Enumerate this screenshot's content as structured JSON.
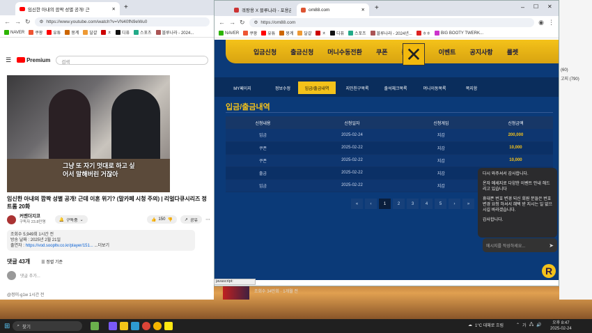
{
  "left_browser": {
    "tab_title": "임신한 아내의 깜짝 성별 공개! 근",
    "url": "https://www.youtube.com/watch?v=VN40fN9eWu0",
    "bookmarks": [
      "NAVER",
      "쿠팡",
      "유튜",
      "뭉계",
      "달걀",
      "ㅊ",
      "디퓨",
      "스포츠",
      "블루나라 - 2024..."
    ],
    "logo_text": "Premium",
    "search_placeholder": "검색",
    "video_title": "임신한 아내의 깜짝 성별 공개! 근데 이혼 위기? (말카페 시청 주의) | 리얼다큐시리즈 정트롬 20화",
    "channel_name": "커맨더지코",
    "subscribers": "구독자 23.8만명",
    "subscribe_label": "구독중",
    "likes": "150",
    "share_label": "공유",
    "desc_line1": "조회수 5,949회 1시간 전",
    "desc_line2": "방송 날짜 : 2025년 2월 21일",
    "desc_line3_prefix": "출연자 : ",
    "desc_link": "https://vod.soopltv.co.kr/player/151...",
    "desc_more": "...더보기",
    "comments_count": "댓글 43개",
    "sort_label": "정렬 기준",
    "add_comment": "댓글 추가...",
    "first_comment": "@정미-g1w 1시간 전",
    "video_caption": "그냥 또 자기 멋대로 하고 싶어서 말해버린 거잖아"
  },
  "right_browser": {
    "tabs": [
      "쿼팡용 X 블루나라 - 포용금 2%",
      "om88.com"
    ],
    "url": "https://om88.com",
    "bookmarks": [
      "NAVER",
      "쿠팡",
      "유튜",
      "뭉계",
      "달걀",
      "ㅊ",
      "디퓨",
      "스포츠",
      "블루나라 - 2024년...",
      "ㅎㅎ",
      "BIG BOOTY TWERK..."
    ],
    "top_nav": [
      "입금신청",
      "출금신청",
      "머니수동전환",
      "쿠폰",
      "콤프신청",
      "이벤트",
      "공지사항",
      "룰렛"
    ],
    "sub_tabs": [
      "MY페이지",
      "정보수정",
      "입금/출금내역",
      "지인친구목록",
      "출석체크목록",
      "머니이동목록",
      "쪽지함"
    ],
    "active_sub_tab": "입금/출금내역",
    "section_title": "입금/출금내역",
    "table_headers": [
      "신청내용",
      "신청일자",
      "신청게임",
      "신청금액"
    ],
    "table_rows": [
      [
        "입금",
        "2025-02-24",
        "지갑",
        "200,000"
      ],
      [
        "쿠폰",
        "2025-02-22",
        "지갑",
        "10,000"
      ],
      [
        "쿠폰",
        "2025-02-22",
        "지갑",
        "10,000"
      ],
      [
        "출금",
        "2025-02-22",
        "지갑",
        ""
      ],
      [
        "입금",
        "2025-02-22",
        "지갑",
        ""
      ]
    ],
    "pager": [
      "«",
      "‹",
      "1",
      "2",
      "3",
      "4",
      "5",
      "›",
      "»"
    ],
    "active_page": "1",
    "chat_messages": [
      "다시 와주셔서 감사합니다.",
      "온자 메세지로 다양한 이벤트 안내 해드리고 있습니다",
      "휴대폰 번호 변경 되신 회원 분들은 번호 변경 요청 하셔서 혜택 받 지시는 일 없으시길 바라겠습니다.",
      "감사합니다."
    ],
    "chat_placeholder": "메시지를 작성하세요...",
    "status_text": "javascript:"
  },
  "background_window": {
    "lines": [
      "(60)",
      "고지 (790)"
    ]
  },
  "thumbnail_text": "조회수 34만회 · 1개월 전",
  "taskbar": {
    "search_label": "찾기",
    "weather": "1°C  대체로 흐림",
    "time": "오후 8:47",
    "date": "2025-02-24"
  },
  "colors": {
    "site_bg": "#0b3a78",
    "site_accent": "#f4c21a",
    "yt_red": "#ff0000"
  }
}
